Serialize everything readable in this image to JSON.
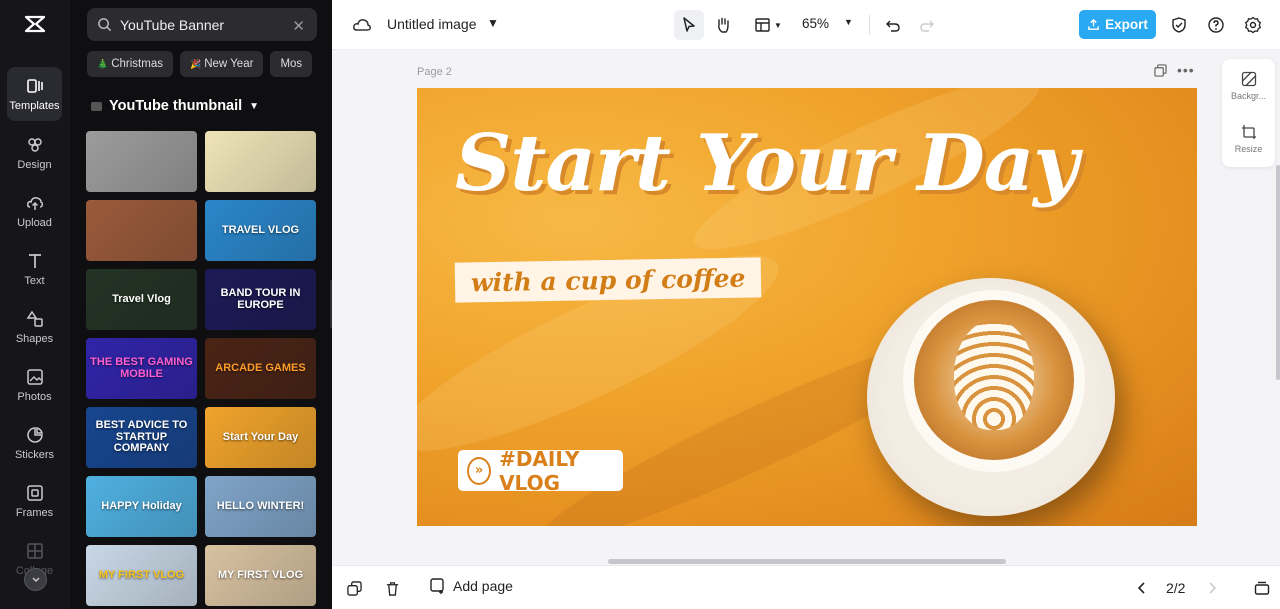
{
  "rail": {
    "items": [
      {
        "label": "Templates",
        "icon": "templates-icon",
        "active": true
      },
      {
        "label": "Design",
        "icon": "design-icon"
      },
      {
        "label": "Upload",
        "icon": "upload-icon"
      },
      {
        "label": "Text",
        "icon": "text-icon"
      },
      {
        "label": "Shapes",
        "icon": "shapes-icon"
      },
      {
        "label": "Photos",
        "icon": "photos-icon"
      },
      {
        "label": "Stickers",
        "icon": "stickers-icon"
      },
      {
        "label": "Frames",
        "icon": "frames-icon"
      },
      {
        "label": "Collage",
        "icon": "collage-icon"
      }
    ]
  },
  "panel": {
    "search_value": "YouTube Banner",
    "chips": [
      "Christmas",
      "New Year",
      "Mos"
    ],
    "category": "YouTube thumbnail",
    "thumbnails": [
      {
        "text": "",
        "bg": "#9c9c9c"
      },
      {
        "text": "",
        "bg": "#efe4b8"
      },
      {
        "text": "",
        "bg": "#9a5a3a"
      },
      {
        "text": "TRAVEL VLOG",
        "bg": "#2a86c9"
      },
      {
        "text": "Travel Vlog",
        "bg": "#233324"
      },
      {
        "text": "BAND TOUR IN EUROPE",
        "bg": "#1c1a55"
      },
      {
        "text": "THE BEST GAMING MOBILE",
        "bg": "#3024a8"
      },
      {
        "text": "ARCADE GAMES",
        "bg": "#4a2415"
      },
      {
        "text": "BEST ADVICE TO STARTUP COMPANY",
        "bg": "#17458f"
      },
      {
        "text": "Start Your Day",
        "bg": "#f0a32b"
      },
      {
        "text": "HAPPY Holiday",
        "bg": "#4fb0e0"
      },
      {
        "text": "HELLO WINTER!",
        "bg": "#7fa4c8"
      },
      {
        "text": "MY FIRST VLOG",
        "bg": "#c9d8e6"
      },
      {
        "text": "MY FIRST VLOG",
        "bg": "#d8c2a0"
      }
    ]
  },
  "topbar": {
    "title": "Untitled image",
    "zoom": "65%",
    "export_label": "Export"
  },
  "canvas": {
    "page_label": "Page 2",
    "headline": "Start Your Day",
    "subtitle": "with a cup of coffee",
    "badge": "#DAILY VLOG"
  },
  "side_tools": {
    "background_label": "Backgr...",
    "resize_label": "Resize"
  },
  "bottombar": {
    "add_page_label": "Add page",
    "page_count": "2/2"
  },
  "colors": {
    "accent": "#28a9f1",
    "rail_bg": "#16161a",
    "panel_bg": "#0f0f12"
  }
}
